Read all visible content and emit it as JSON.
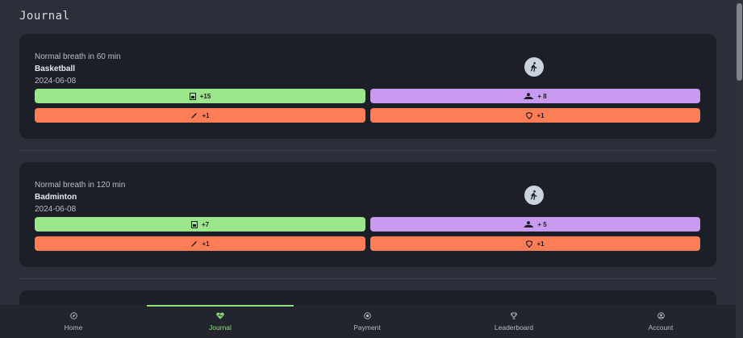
{
  "header": {
    "title": "Journal"
  },
  "entries": [
    {
      "breath": "Normal breath in 60 min",
      "sport": "Basketball",
      "date": "2024-06-08",
      "activity_icon": "walking-person-icon",
      "stats": {
        "green_icon": "glass-icon",
        "green_value": "+15",
        "purple_icon": "hand-icon",
        "purple_value": "+ 8",
        "orange_left_icon": "pencil-icon",
        "orange_left_value": "+1",
        "orange_right_icon": "shield-icon",
        "orange_right_value": "+1"
      }
    },
    {
      "breath": "Normal breath in 120 min",
      "sport": "Badminton",
      "date": "2024-06-08",
      "activity_icon": "walking-person-icon",
      "stats": {
        "green_icon": "glass-icon",
        "green_value": "+7",
        "purple_icon": "hand-icon",
        "purple_value": "+ 5",
        "orange_left_icon": "pencil-icon",
        "orange_left_value": "+1",
        "orange_right_icon": "shield-icon",
        "orange_right_value": "+1"
      }
    }
  ],
  "nav": {
    "items": [
      {
        "label": "Home",
        "icon": "compass-icon"
      },
      {
        "label": "Journal",
        "icon": "heart-pulse-icon",
        "active": true
      },
      {
        "label": "Payment",
        "icon": "coin-icon"
      },
      {
        "label": "Leaderboard",
        "icon": "trophy-icon"
      },
      {
        "label": "Account",
        "icon": "user-circle-icon"
      }
    ]
  },
  "colors": {
    "background": "#2b2f39",
    "card": "#1c1f27",
    "green": "#9be58a",
    "purple": "#c99af0",
    "orange": "#fd7e56",
    "active_nav": "#8fe27a"
  }
}
